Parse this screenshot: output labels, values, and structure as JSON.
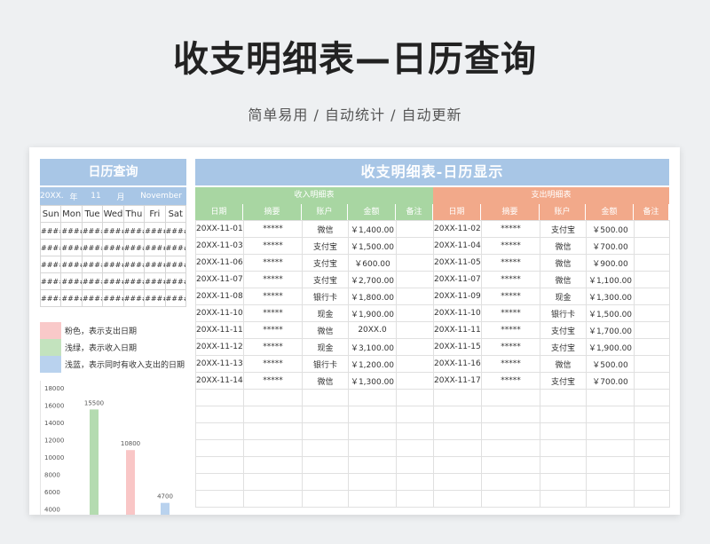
{
  "page": {
    "title": "收支明细表—日历查询",
    "subtitle": "简单易用 / 自动统计 / 自动更新"
  },
  "calendar": {
    "title": "日历查询",
    "year": "20XX.",
    "year_unit": "年",
    "month": "11",
    "month_unit": "月",
    "month_name": "November",
    "weekdays": [
      "Sun",
      "Mon",
      "Tue",
      "Wed",
      "Thu",
      "Fri",
      "Sat"
    ],
    "cell_placeholder": "####"
  },
  "legend": [
    {
      "text": "粉色，表示支出日期",
      "color": "#f9c9c9"
    },
    {
      "text": "浅绿，表示收入日期",
      "color": "#c3e3be"
    },
    {
      "text": "浅蓝，表示同时有收入支出的日期",
      "color": "#b9d2ee"
    }
  ],
  "chart_data": {
    "type": "bar",
    "y_ticks": [
      "18000",
      "16000",
      "14000",
      "12000",
      "10000",
      "8000",
      "6000",
      "4000"
    ],
    "ylim": [
      4000,
      18000
    ],
    "series": [
      {
        "value": 15500,
        "label": "15500",
        "color": "#b4dbb0"
      },
      {
        "value": 10800,
        "label": "10800",
        "color": "#f9c6c6"
      },
      {
        "value": 4700,
        "label": "4700",
        "color": "#b9d2ee"
      }
    ]
  },
  "detail": {
    "title": "收支明细表-日历显示",
    "income_title": "收入明细表",
    "expense_title": "支出明细表",
    "columns": [
      "日期",
      "摘要",
      "账户",
      "金额",
      "备注"
    ],
    "income_rows": [
      {
        "date": "20XX-11-01 00:00",
        "memo": "*****",
        "account": "微信",
        "amount": "￥1,400.00",
        "note": ""
      },
      {
        "date": "20XX-11-03 00:00",
        "memo": "*****",
        "account": "支付宝",
        "amount": "￥1,500.00",
        "note": ""
      },
      {
        "date": "20XX-11-06 00:00",
        "memo": "*****",
        "account": "支付宝",
        "amount": "￥600.00",
        "note": ""
      },
      {
        "date": "20XX-11-07 00:00",
        "memo": "*****",
        "account": "支付宝",
        "amount": "￥2,700.00",
        "note": ""
      },
      {
        "date": "20XX-11-08 00:00",
        "memo": "*****",
        "account": "银行卡",
        "amount": "￥1,800.00",
        "note": ""
      },
      {
        "date": "20XX-11-10 00:00",
        "memo": "*****",
        "account": "现金",
        "amount": "￥1,900.00",
        "note": ""
      },
      {
        "date": "20XX-11-11 00:00",
        "memo": "*****",
        "account": "微信",
        "amount": "20XX.0",
        "note": ""
      },
      {
        "date": "20XX-11-12 00:00",
        "memo": "*****",
        "account": "现金",
        "amount": "￥3,100.00",
        "note": ""
      },
      {
        "date": "20XX-11-13 00:00",
        "memo": "*****",
        "account": "银行卡",
        "amount": "￥1,200.00",
        "note": ""
      },
      {
        "date": "20XX-11-14 00:00",
        "memo": "*****",
        "account": "微信",
        "amount": "￥1,300.00",
        "note": ""
      }
    ],
    "expense_rows": [
      {
        "date": "20XX-11-02 00:00",
        "memo": "*****",
        "account": "支付宝",
        "amount": "￥500.00",
        "note": ""
      },
      {
        "date": "20XX-11-04 00:00",
        "memo": "*****",
        "account": "微信",
        "amount": "￥700.00",
        "note": ""
      },
      {
        "date": "20XX-11-05 00:00",
        "memo": "*****",
        "account": "微信",
        "amount": "￥900.00",
        "note": ""
      },
      {
        "date": "20XX-11-07 00:00",
        "memo": "*****",
        "account": "微信",
        "amount": "￥1,100.00",
        "note": ""
      },
      {
        "date": "20XX-11-09 00:00",
        "memo": "*****",
        "account": "现金",
        "amount": "￥1,300.00",
        "note": ""
      },
      {
        "date": "20XX-11-10 00:00",
        "memo": "*****",
        "account": "银行卡",
        "amount": "￥1,500.00",
        "note": ""
      },
      {
        "date": "20XX-11-11 00:00",
        "memo": "*****",
        "account": "支付宝",
        "amount": "￥1,700.00",
        "note": ""
      },
      {
        "date": "20XX-11-15 00:00",
        "memo": "*****",
        "account": "支付宝",
        "amount": "￥1,900.00",
        "note": ""
      },
      {
        "date": "20XX-11-16 00:00",
        "memo": "*****",
        "account": "微信",
        "amount": "￥500.00",
        "note": ""
      },
      {
        "date": "20XX-11-17 00:00",
        "memo": "*****",
        "account": "支付宝",
        "amount": "￥700.00",
        "note": ""
      }
    ]
  }
}
